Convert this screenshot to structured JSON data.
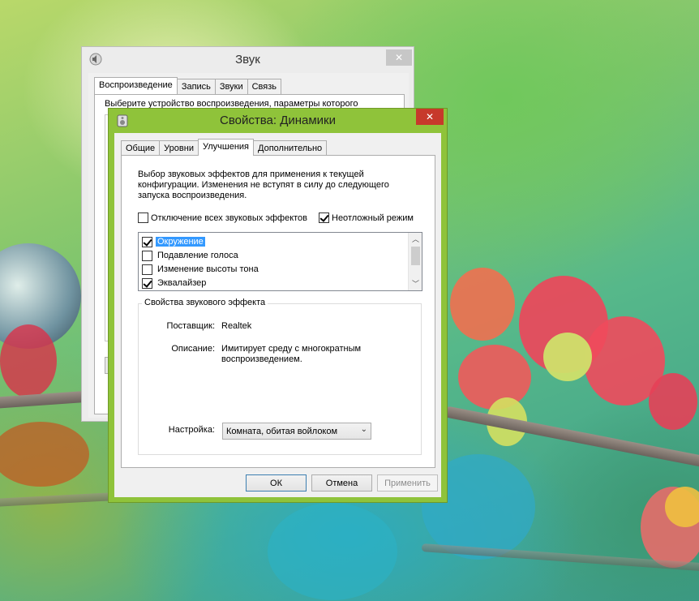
{
  "sound_window": {
    "title": "Звук",
    "tabs": [
      {
        "label": "Воспроизведение",
        "active": true
      },
      {
        "label": "Запись",
        "active": false
      },
      {
        "label": "Звуки",
        "active": false
      },
      {
        "label": "Связь",
        "active": false
      }
    ],
    "instruction": "Выберите устройство воспроизведения, параметры которого"
  },
  "properties_dialog": {
    "title": "Свойства: Динамики",
    "tabs": [
      {
        "label": "Общие",
        "active": false
      },
      {
        "label": "Уровни",
        "active": false
      },
      {
        "label": "Улучшения",
        "active": true
      },
      {
        "label": "Дополнительно",
        "active": false
      }
    ],
    "description": "Выбор звуковых эффектов для применения к текущей конфигурации. Изменения не вступят в силу до следующего запуска воспроизведения.",
    "disable_all": {
      "label": "Отключение всех звуковых эффектов",
      "checked": false
    },
    "immediate_mode": {
      "label": "Неотложный режим",
      "checked": true
    },
    "effects": [
      {
        "label": "Окружение",
        "checked": true,
        "selected": true
      },
      {
        "label": "Подавление голоса",
        "checked": false,
        "selected": false
      },
      {
        "label": "Изменение высоты тона",
        "checked": false,
        "selected": false
      },
      {
        "label": "Эквалайзер",
        "checked": true,
        "selected": false
      }
    ],
    "effect_props": {
      "group_title": "Свойства звукового эффекта",
      "provider_label": "Поставщик:",
      "provider_value": "Realtek",
      "description_label": "Описание:",
      "description_value": "Имитирует среду с многократным воспроизведением.",
      "setting_label": "Настройка:",
      "setting_value": "Комната, обитая войлоком"
    },
    "buttons": {
      "ok": "ОК",
      "cancel": "Отмена",
      "apply": "Применить"
    }
  },
  "colors": {
    "accent_frame": "#8fc33a",
    "close_red": "#c7392b",
    "selection": "#3399ff"
  },
  "icons": [
    "speaker-icon",
    "close-icon",
    "checkmark-icon",
    "scroll-up-icon",
    "scroll-down-icon",
    "dropdown-arrow-icon"
  ]
}
